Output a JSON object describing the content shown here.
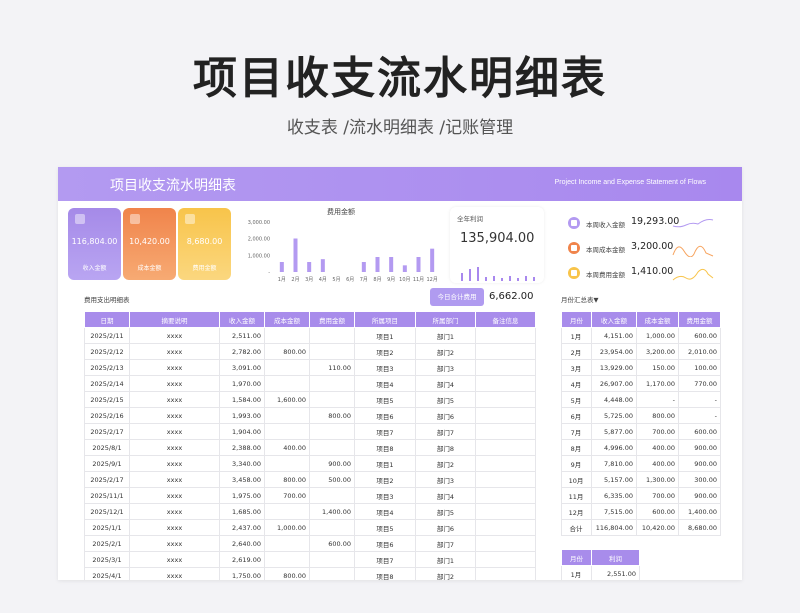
{
  "page": {
    "title": "项目收支流水明细表",
    "subtitle": "收支表 /流水明细表 /记账管理"
  },
  "banner": {
    "title": "项目收支流水明细表",
    "subtitle": "Project Income and Expense Statement of Flows"
  },
  "kpis": [
    {
      "value": "116,804.00",
      "label": "收入金额",
      "icon": "wallet-icon",
      "color": "#a58ae8"
    },
    {
      "value": "10,420.00",
      "label": "成本金额",
      "icon": "box-icon",
      "color": "#f0844b"
    },
    {
      "value": "8,680.00",
      "label": "费用金额",
      "icon": "chart-icon",
      "color": "#f8c44a"
    }
  ],
  "chart_data": {
    "type": "bar",
    "title": "费用金额",
    "categories": [
      "1月",
      "2月",
      "3月",
      "4月",
      "5月",
      "6月",
      "7月",
      "8月",
      "9月",
      "10月",
      "11月",
      "12月"
    ],
    "values": [
      600,
      2010,
      600,
      770,
      0,
      0,
      600,
      900,
      900,
      400,
      900,
      1400
    ],
    "yticks": [
      "3,000.00",
      "2,000.00",
      "1,000.00",
      "-"
    ],
    "ylim": [
      0,
      3000
    ],
    "bar_color": "#b39af1"
  },
  "profit": {
    "label": "全年利润",
    "value": "135,904.00"
  },
  "weekly": [
    {
      "label": "本周收入金额",
      "value": "19,293.00",
      "icon": "wallet-icon",
      "color": "#b39af1"
    },
    {
      "label": "本周成本金额",
      "value": "3,200.00",
      "icon": "box-icon",
      "color": "#f0844b"
    },
    {
      "label": "本周费用金额",
      "value": "1,410.00",
      "icon": "chart-icon",
      "color": "#f8c44a"
    }
  ],
  "detail": {
    "title": "费用支出明细表",
    "today_label": "今日合计费用",
    "today_value": "6,662.00",
    "columns": [
      "日期",
      "摘要说明",
      "收入金额",
      "成本金额",
      "费用金额",
      "所属项目",
      "所属部门",
      "备注信息"
    ],
    "rows": [
      [
        "2025/2/11",
        "xxxx",
        "2,511.00",
        "",
        "",
        "项目1",
        "部门1",
        ""
      ],
      [
        "2025/2/12",
        "xxxx",
        "2,782.00",
        "800.00",
        "",
        "项目2",
        "部门2",
        ""
      ],
      [
        "2025/2/13",
        "xxxx",
        "3,091.00",
        "",
        "110.00",
        "项目3",
        "部门3",
        ""
      ],
      [
        "2025/2/14",
        "xxxx",
        "1,970.00",
        "",
        "",
        "项目4",
        "部门4",
        ""
      ],
      [
        "2025/2/15",
        "xxxx",
        "1,584.00",
        "1,600.00",
        "",
        "项目5",
        "部门5",
        ""
      ],
      [
        "2025/2/16",
        "xxxx",
        "1,993.00",
        "",
        "800.00",
        "项目6",
        "部门6",
        ""
      ],
      [
        "2025/2/17",
        "xxxx",
        "1,904.00",
        "",
        "",
        "项目7",
        "部门7",
        ""
      ],
      [
        "2025/8/1",
        "xxxx",
        "2,388.00",
        "400.00",
        "",
        "项目8",
        "部门8",
        ""
      ],
      [
        "2025/9/1",
        "xxxx",
        "3,340.00",
        "",
        "900.00",
        "项目1",
        "部门2",
        ""
      ],
      [
        "2025/2/17",
        "xxxx",
        "3,458.00",
        "800.00",
        "500.00",
        "项目2",
        "部门3",
        ""
      ],
      [
        "2025/11/1",
        "xxxx",
        "1,975.00",
        "700.00",
        "",
        "项目3",
        "部门4",
        ""
      ],
      [
        "2025/12/1",
        "xxxx",
        "1,685.00",
        "",
        "1,400.00",
        "项目4",
        "部门5",
        ""
      ],
      [
        "2025/1/1",
        "xxxx",
        "2,437.00",
        "1,000.00",
        "",
        "项目5",
        "部门6",
        ""
      ],
      [
        "2025/2/1",
        "xxxx",
        "2,640.00",
        "",
        "600.00",
        "项目6",
        "部门7",
        ""
      ],
      [
        "2025/3/1",
        "xxxx",
        "2,619.00",
        "",
        "",
        "项目7",
        "部门1",
        ""
      ],
      [
        "2025/4/1",
        "xxxx",
        "1,750.00",
        "800.00",
        "",
        "项目8",
        "部门2",
        ""
      ]
    ]
  },
  "summary": {
    "title": "月份汇总表▼",
    "columns": [
      "月份",
      "收入金额",
      "成本金额",
      "费用金额"
    ],
    "rows": [
      [
        "1月",
        "4,151.00",
        "1,000.00",
        "600.00"
      ],
      [
        "2月",
        "23,954.00",
        "3,200.00",
        "2,010.00"
      ],
      [
        "3月",
        "13,929.00",
        "150.00",
        "100.00"
      ],
      [
        "4月",
        "26,907.00",
        "1,170.00",
        "770.00"
      ],
      [
        "5月",
        "4,448.00",
        "-",
        "-"
      ],
      [
        "6月",
        "5,725.00",
        "800.00",
        "-"
      ],
      [
        "7月",
        "5,877.00",
        "700.00",
        "600.00"
      ],
      [
        "8月",
        "4,996.00",
        "400.00",
        "900.00"
      ],
      [
        "9月",
        "7,810.00",
        "400.00",
        "900.00"
      ],
      [
        "10月",
        "5,157.00",
        "1,300.00",
        "300.00"
      ],
      [
        "11月",
        "6,335.00",
        "700.00",
        "900.00"
      ],
      [
        "12月",
        "7,515.00",
        "600.00",
        "1,400.00"
      ],
      [
        "合计",
        "116,804.00",
        "10,420.00",
        "8,680.00"
      ]
    ]
  },
  "profit_table": {
    "columns": [
      "月份",
      "利润"
    ],
    "rows": [
      [
        "1月",
        "2,551.00"
      ]
    ]
  }
}
